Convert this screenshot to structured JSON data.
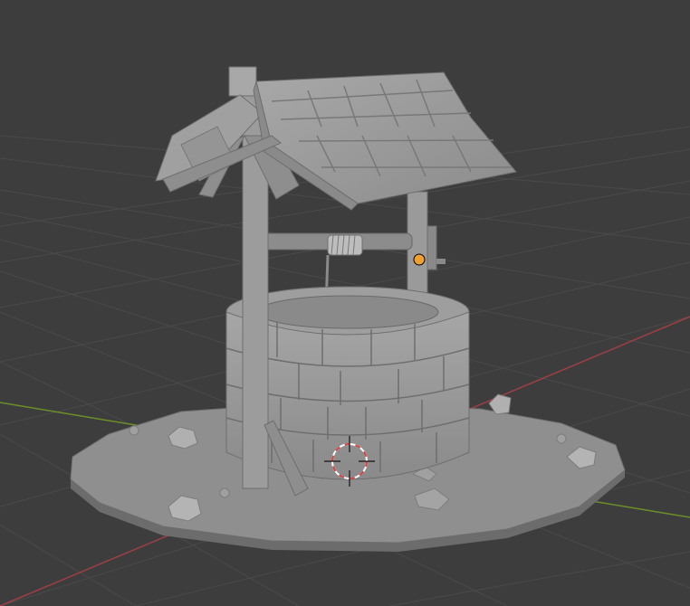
{
  "viewport": {
    "kind": "3d-viewport",
    "background_color": "#3d3d3d",
    "grid_color": "#4a4a4a",
    "axis_x_color": "#9e3f44",
    "axis_y_color": "#6c8f2a"
  },
  "scene": {
    "object": "stone-well",
    "material_color": "#9a9a9a",
    "origin_marker_color": "#f0a030",
    "cursor_color": "#d44444"
  },
  "icons": {
    "origin": "object-origin-dot-icon",
    "cursor": "3d-cursor-icon"
  }
}
